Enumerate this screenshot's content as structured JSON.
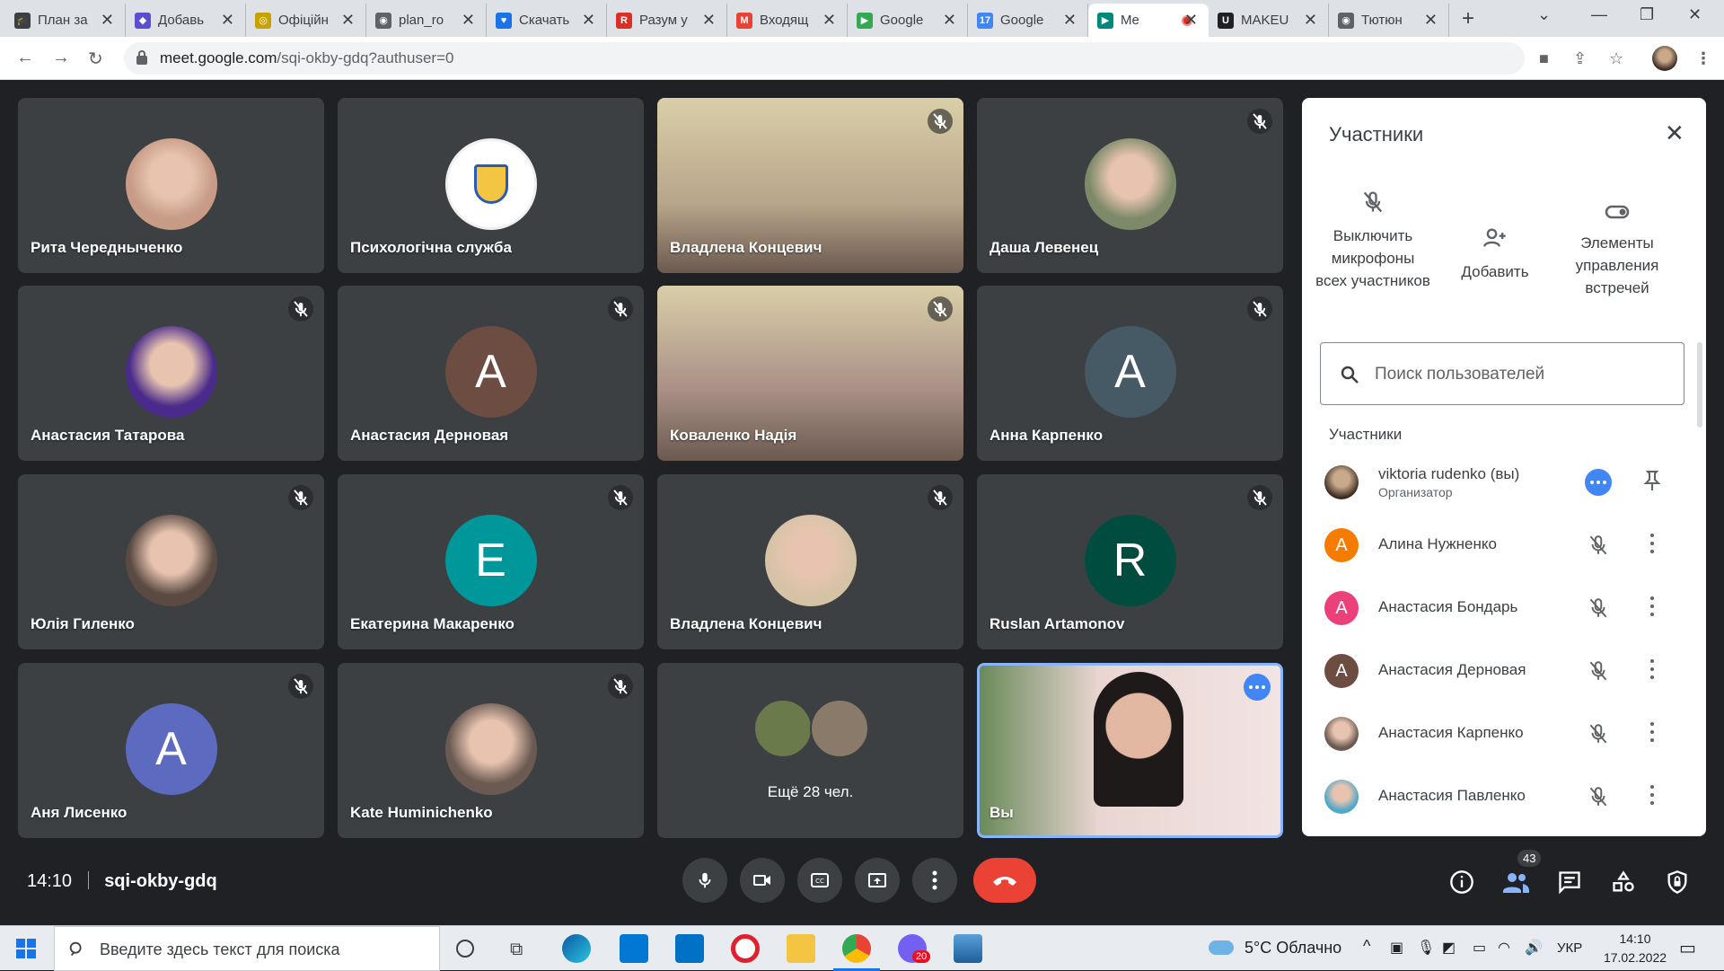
{
  "browser": {
    "tabs": [
      {
        "title": "План за",
        "color": "#3c4043",
        "glyph": "🎓"
      },
      {
        "title": "Добавь",
        "color": "#5b4fcf",
        "glyph": "◆"
      },
      {
        "title": "Офіційн",
        "color": "#c8a200",
        "glyph": "◎"
      },
      {
        "title": "plan_ro",
        "color": "#5f6368",
        "glyph": "◉"
      },
      {
        "title": "Скачать",
        "color": "#1a73e8",
        "glyph": "♥"
      },
      {
        "title": "Разум у",
        "color": "#d93025",
        "glyph": "R"
      },
      {
        "title": "Входящ",
        "color": "#ea4335",
        "glyph": "M"
      },
      {
        "title": "Google",
        "color": "#34a853",
        "glyph": "▶"
      },
      {
        "title": "Google",
        "color": "#4285f4",
        "glyph": "17"
      },
      {
        "title": "Me",
        "color": "#00897b",
        "glyph": "▶",
        "active": true
      },
      {
        "title": "MAKEU",
        "color": "#202124",
        "glyph": "U"
      },
      {
        "title": "Тютюн",
        "color": "#5f6368",
        "glyph": "◉"
      }
    ],
    "url_host": "meet.google.com",
    "url_path": "/sqi-okby-gdq?authuser=0"
  },
  "tiles": [
    {
      "name": "Рита Чередныченко",
      "avatar": "photo",
      "color": "#c79b85"
    },
    {
      "name": "Психологічна служба",
      "avatar": "logo",
      "color": "#ffffff"
    },
    {
      "name": "Владлена Концевич",
      "avatar": "video",
      "color": "#b8a58a",
      "muted": true
    },
    {
      "name": "Даша Левенец",
      "avatar": "photo",
      "color": "#7d8a6a",
      "muted": true
    },
    {
      "name": "Анастасия Татарова",
      "avatar": "photo",
      "color": "#4a2a8a",
      "muted": true
    },
    {
      "name": "Анастасия Дерновая",
      "avatar": "letter",
      "letter": "А",
      "color": "#6d4c41",
      "muted": true
    },
    {
      "name": "Коваленко Надія",
      "avatar": "video",
      "color": "#a98f86",
      "muted": true
    },
    {
      "name": "Анна Карпенко",
      "avatar": "letter",
      "letter": "А",
      "color": "#455a64",
      "muted": true
    },
    {
      "name": "Юлія Гиленко",
      "avatar": "photo",
      "color": "#5a4a42",
      "muted": true
    },
    {
      "name": "Екатерина Макаренко",
      "avatar": "letter",
      "letter": "Е",
      "color": "#00979b",
      "muted": true
    },
    {
      "name": "Владлена Концевич",
      "avatar": "photo",
      "color": "#d6c3a6",
      "muted": true
    },
    {
      "name": "Ruslan Artamonov",
      "avatar": "letter",
      "letter": "R",
      "color": "#004d40",
      "muted": true
    },
    {
      "name": "Аня Лисенко",
      "avatar": "letter",
      "letter": "А",
      "color": "#5c6bc0",
      "muted": true
    },
    {
      "name": "Kate Huminichenko",
      "avatar": "photo",
      "color": "#6b5a52",
      "muted": true
    },
    {
      "name": "",
      "avatar": "group",
      "color": "#3c4043",
      "more_label": "Ещё 28 чел."
    },
    {
      "name": "Вы",
      "avatar": "self",
      "color": "#e9d6d2"
    }
  ],
  "meeting": {
    "time": "14:10",
    "code": "sqi-okby-gdq",
    "participants_count": "43"
  },
  "panel": {
    "title": "Участники",
    "actions": [
      {
        "label": "Выключить микрофоны всех участников"
      },
      {
        "label": "Добавить"
      },
      {
        "label": "Элементы управления встречей"
      }
    ],
    "search_placeholder": "Поиск пользователей",
    "section_label": "Участники",
    "me": {
      "name": "viktoria rudenko (вы)",
      "role": "Организатор"
    },
    "people": [
      {
        "name": "Алина Нужненко",
        "letter": "А",
        "color": "#f57c00"
      },
      {
        "name": "Анастасия Бондарь",
        "letter": "А",
        "color": "#ec407a"
      },
      {
        "name": "Анастасия Дерновая",
        "letter": "А",
        "color": "#6d4c41"
      },
      {
        "name": "Анастасия Карпенко",
        "letter": "",
        "color": "#6a5a50"
      },
      {
        "name": "Анастасия Павленко",
        "letter": "",
        "color": "#4fa7c9"
      }
    ]
  },
  "taskbar": {
    "search_placeholder": "Введите здесь текст для поиска",
    "weather": "5°C Облачно",
    "lang": "УКР",
    "clock_time": "14:10",
    "clock_date": "17.02.2022",
    "viber_badge": "20"
  }
}
